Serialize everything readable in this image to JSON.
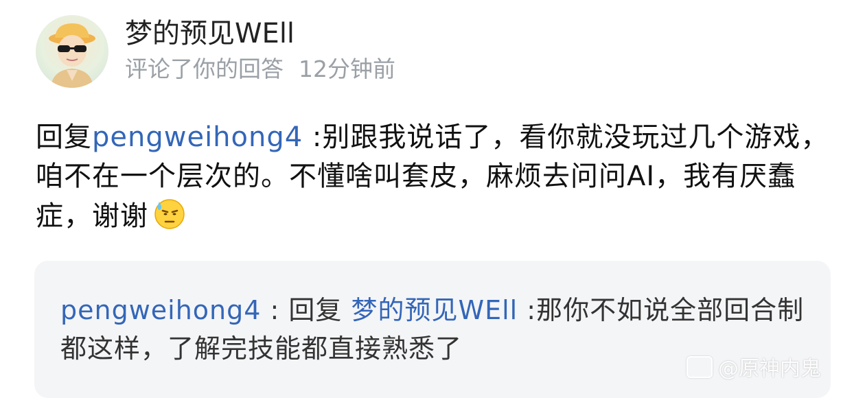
{
  "user": {
    "name": "梦的预见WEll",
    "action": "评论了你的回答",
    "time": "12分钟前"
  },
  "comment": {
    "prefix": "回复",
    "mention": "pengweihong4",
    "text": " :别跟我说话了，看你就没玩过几个游戏，咱不在一个层次的。不懂啥叫套皮，麻烦去问问AI，我有厌蠢症，谢谢",
    "emoji": "sweat-smile-emoji"
  },
  "quote": {
    "author": "pengweihong4",
    "separator": " : ",
    "prefix": "回复 ",
    "mention": "梦的预见WEll",
    "text": " :那你不如说全部回合制都这样，了解完技能都直接熟悉了"
  },
  "watermark": {
    "text": "@原神内鬼"
  }
}
